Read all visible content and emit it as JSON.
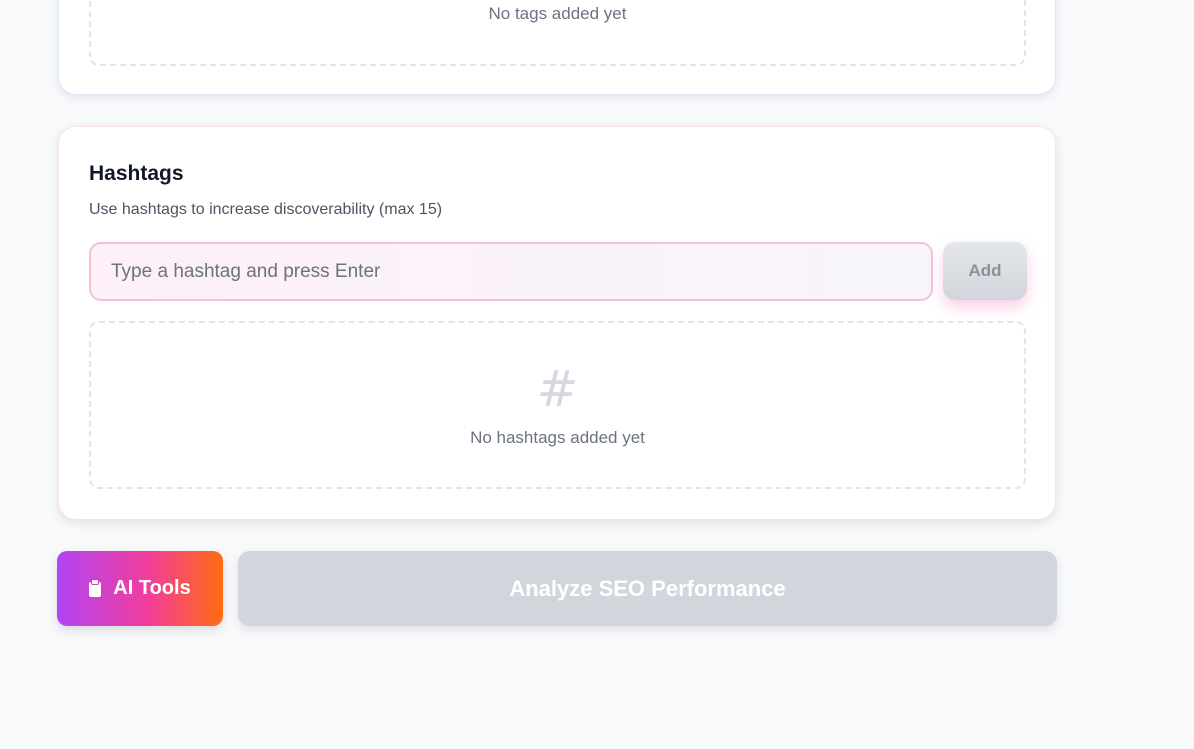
{
  "tags_section": {
    "empty_text": "No tags added yet"
  },
  "hashtags_section": {
    "title": "Hashtags",
    "description": "Use hashtags to increase discoverability (max 15)",
    "input_placeholder": "Type a hashtag and press Enter",
    "input_value": "",
    "add_label": "Add",
    "empty_icon": "#",
    "empty_text": "No hashtags added yet"
  },
  "actions": {
    "ai_tools_label": "AI Tools",
    "ai_tools_icon": "clipboard-icon",
    "analyze_label": "Analyze SEO Performance"
  }
}
